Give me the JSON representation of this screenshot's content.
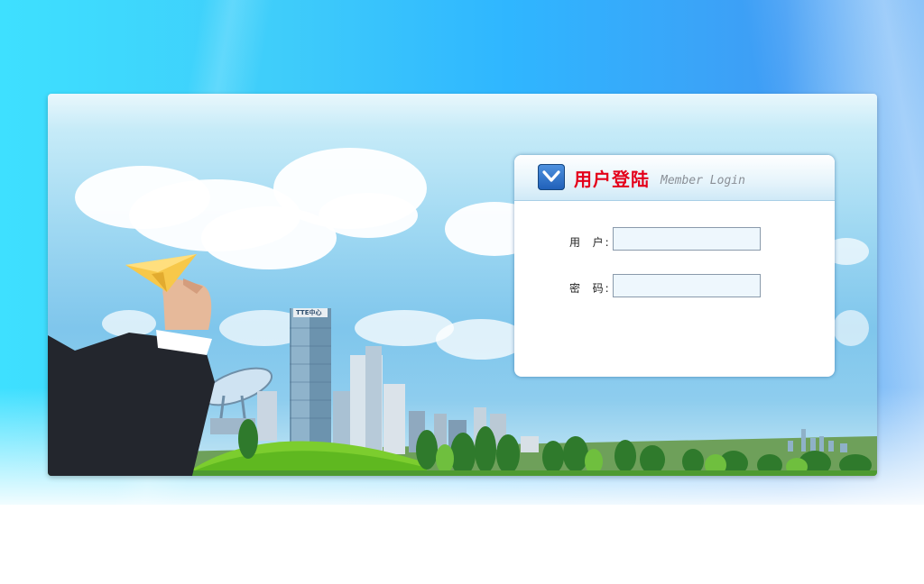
{
  "login": {
    "title": "用户登陆",
    "subtitle": "Member Login",
    "icon": "chevron-down-icon",
    "username_label": "用  户:",
    "username_value": "",
    "password_label": "密  码:",
    "password_value": ""
  },
  "colors": {
    "title_red": "#e4001a",
    "icon_blue": "#1f5fb8",
    "input_bg": "#eef7fd"
  },
  "background": {
    "building_sign": "TTE中心"
  }
}
